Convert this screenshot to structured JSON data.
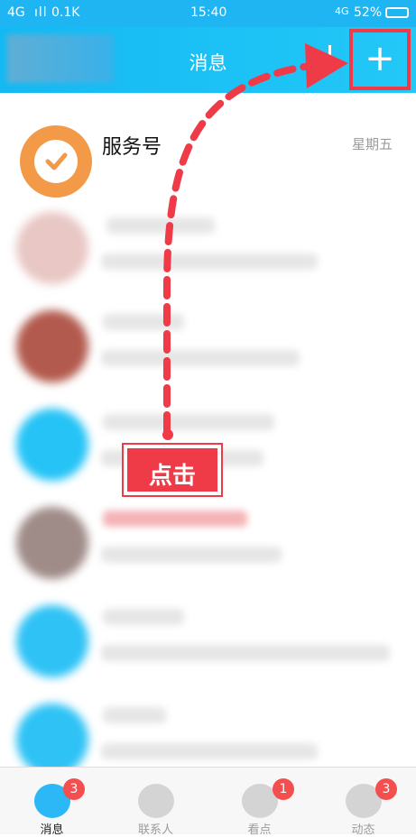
{
  "status": {
    "network": "4G",
    "speed": "0.1K",
    "time": "15:40",
    "network_right": "4G",
    "battery": "52%"
  },
  "header": {
    "title": "消息",
    "plus": "+"
  },
  "service": {
    "title": "服务号",
    "time": "星期五"
  },
  "annotation": {
    "text": "点击"
  },
  "tabs": [
    {
      "label": "消息",
      "badge": "3",
      "color": "#2cb8f6"
    },
    {
      "label": "联系人",
      "badge": "",
      "color": "#9c9c9c"
    },
    {
      "label": "看点",
      "badge": "1",
      "color": "#9c9c9c"
    },
    {
      "label": "动态",
      "badge": "3",
      "color": "#9c9c9c"
    }
  ],
  "colors": {
    "accent": "#1fb4f2",
    "highlight": "#ef3b48",
    "service": "#f39a49"
  }
}
